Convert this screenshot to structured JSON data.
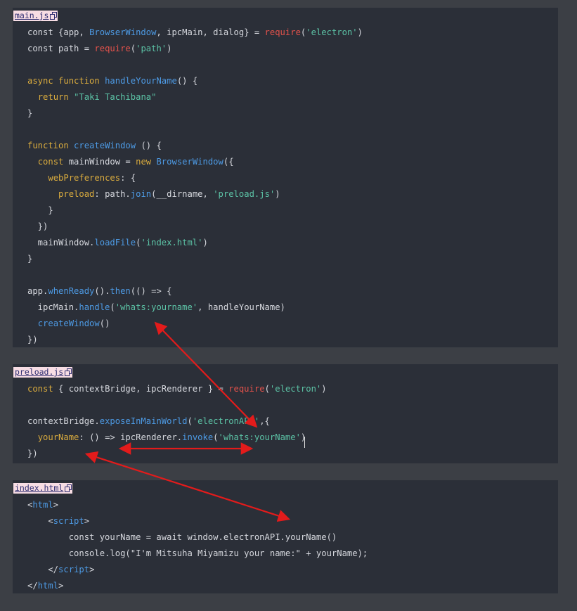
{
  "files": [
    {
      "name": "main.js"
    },
    {
      "name": "preload.js"
    },
    {
      "name": "index.html"
    }
  ],
  "main": [
    [
      [
        "const {app, ",
        "pl"
      ],
      [
        "BrowserWindow",
        "fn"
      ],
      [
        ", ipcMain, dialog} = ",
        "pl"
      ],
      [
        "require",
        "req"
      ],
      [
        "(",
        "pl"
      ],
      [
        "'electron'",
        "str"
      ],
      [
        ")",
        "pl"
      ]
    ],
    [
      [
        "const path = ",
        "pl"
      ],
      [
        "require",
        "req"
      ],
      [
        "(",
        "pl"
      ],
      [
        "'path'",
        "str"
      ],
      [
        ")",
        "pl"
      ]
    ],
    [],
    [
      [
        "async ",
        "kw"
      ],
      [
        "function ",
        "kw"
      ],
      [
        "handleYourName",
        "fn"
      ],
      [
        "() {",
        "pl"
      ]
    ],
    [
      [
        "  ",
        "pl"
      ],
      [
        "return ",
        "kw"
      ],
      [
        "\"Taki Tachibana\"",
        "str"
      ]
    ],
    [
      [
        "}",
        "pl"
      ]
    ],
    [],
    [
      [
        "function ",
        "kw"
      ],
      [
        "createWindow",
        "fn"
      ],
      [
        " () {",
        "pl"
      ]
    ],
    [
      [
        "  ",
        "pl"
      ],
      [
        "const ",
        "kw"
      ],
      [
        "mainWindow = ",
        "pl"
      ],
      [
        "new ",
        "kw"
      ],
      [
        "BrowserWindow",
        "fn"
      ],
      [
        "({",
        "pl"
      ]
    ],
    [
      [
        "    ",
        "pl"
      ],
      [
        "webPreferences",
        "prop"
      ],
      [
        ": {",
        "pl"
      ]
    ],
    [
      [
        "      ",
        "pl"
      ],
      [
        "preload",
        "prop"
      ],
      [
        ": path.",
        "pl"
      ],
      [
        "join",
        "fn"
      ],
      [
        "(__dirname, ",
        "pl"
      ],
      [
        "'preload.js'",
        "str"
      ],
      [
        ")",
        "pl"
      ]
    ],
    [
      [
        "    }",
        "pl"
      ]
    ],
    [
      [
        "  })",
        "pl"
      ]
    ],
    [
      [
        "  mainWindow.",
        "pl"
      ],
      [
        "loadFile",
        "fn"
      ],
      [
        "(",
        "pl"
      ],
      [
        "'index.html'",
        "str"
      ],
      [
        ")",
        "pl"
      ]
    ],
    [
      [
        "}",
        "pl"
      ]
    ],
    [],
    [
      [
        "app.",
        "pl"
      ],
      [
        "whenReady",
        "fn"
      ],
      [
        "().",
        "pl"
      ],
      [
        "then",
        "fn"
      ],
      [
        "(() => {",
        "pl"
      ]
    ],
    [
      [
        "  ipcMain.",
        "pl"
      ],
      [
        "handle",
        "fn"
      ],
      [
        "(",
        "pl"
      ],
      [
        "'whats:yourname'",
        "str"
      ],
      [
        ", handleYourName)",
        "pl"
      ]
    ],
    [
      [
        "  ",
        "pl"
      ],
      [
        "createWindow",
        "fn"
      ],
      [
        "()",
        "pl"
      ]
    ],
    [
      [
        "})",
        "pl"
      ]
    ]
  ],
  "preload": [
    [
      [
        "const ",
        "kw"
      ],
      [
        "{ contextBridge, ipcRenderer } = ",
        "pl"
      ],
      [
        "require",
        "req"
      ],
      [
        "(",
        "pl"
      ],
      [
        "'electron'",
        "str"
      ],
      [
        ")",
        "pl"
      ]
    ],
    [],
    [
      [
        "contextBridge.",
        "pl"
      ],
      [
        "exposeInMainWorld",
        "fn"
      ],
      [
        "(",
        "pl"
      ],
      [
        "'electronAPI'",
        "str"
      ],
      [
        ",{",
        "pl"
      ]
    ],
    [
      [
        "  ",
        "pl"
      ],
      [
        "yourName",
        "prop"
      ],
      [
        ": () => ipcRenderer.",
        "pl"
      ],
      [
        "invoke",
        "fn"
      ],
      [
        "(",
        "pl"
      ],
      [
        "'whats:yourName'",
        "str"
      ],
      [
        ")",
        "pl"
      ]
    ],
    [
      [
        "})",
        "pl"
      ]
    ]
  ],
  "index": [
    [
      [
        "<",
        "pl"
      ],
      [
        "html",
        "tag"
      ],
      [
        ">",
        "pl"
      ]
    ],
    [
      [
        "    <",
        "pl"
      ],
      [
        "script",
        "tag"
      ],
      [
        ">",
        "pl"
      ]
    ],
    [
      [
        "        const yourName = await window.electronAPI.yourName()",
        "pl"
      ]
    ],
    [
      [
        "        console.log(\"I'm Mitsuha Miyamizu your name:\" + yourName);",
        "pl"
      ]
    ],
    [
      [
        "    </",
        "pl"
      ],
      [
        "script",
        "tag"
      ],
      [
        ">",
        "pl"
      ]
    ],
    [
      [
        "</",
        "pl"
      ],
      [
        "html",
        "tag"
      ],
      [
        ">",
        "pl"
      ]
    ]
  ],
  "colors": {
    "background": "#3c3f45",
    "code_block": "#2b2f38",
    "filetag_bg": "#f7dde4",
    "keyword": "#d9ab3e",
    "function": "#4d9ae4",
    "require": "#e4524b",
    "string": "#5cc3a6",
    "arrow": "#e31b1b"
  }
}
